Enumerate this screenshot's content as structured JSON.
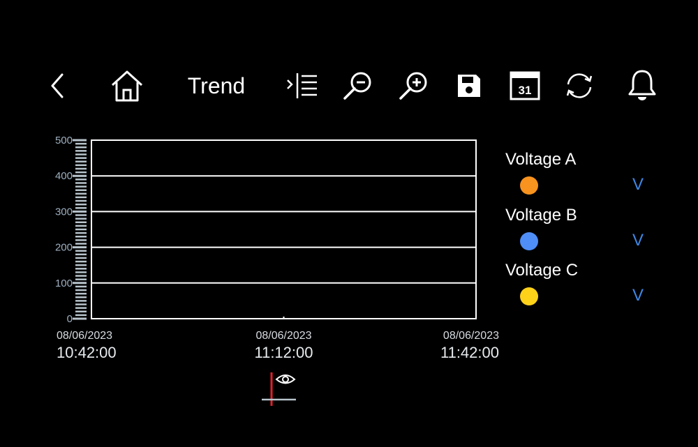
{
  "toolbar": {
    "title": "Trend",
    "buttons": [
      {
        "name": "back-button",
        "icon": "chevron-left-icon"
      },
      {
        "name": "home-button",
        "icon": "home-icon"
      },
      {
        "name": "legend-toggle-button",
        "icon": "list-expand-icon"
      },
      {
        "name": "zoom-out-button",
        "icon": "zoom-out-icon"
      },
      {
        "name": "zoom-in-button",
        "icon": "zoom-in-icon"
      },
      {
        "name": "save-button",
        "icon": "floppy-disk-icon"
      },
      {
        "name": "calendar-button",
        "icon": "calendar-icon",
        "calendar_day": "31"
      },
      {
        "name": "refresh-button",
        "icon": "refresh-icon"
      },
      {
        "name": "alarm-button",
        "icon": "bell-icon"
      }
    ]
  },
  "chart_data": {
    "type": "line",
    "y_ticks": [
      "500",
      "400",
      "300",
      "200",
      "100",
      "0"
    ],
    "ylim": [
      0,
      500
    ],
    "grid": true,
    "x_ticks": [
      {
        "date": "08/06/2023",
        "time": "10:42:00"
      },
      {
        "date": "08/06/2023",
        "time": "11:12:00"
      },
      {
        "date": "08/06/2023",
        "time": "11:42:00"
      }
    ],
    "series": [
      {
        "name": "Voltage A",
        "color": "#f7931e",
        "unit": "V",
        "values": []
      },
      {
        "name": "Voltage B",
        "color": "#4f8ef7",
        "unit": "V",
        "values": []
      },
      {
        "name": "Voltage C",
        "color": "#ffd21a",
        "unit": "V",
        "values": []
      }
    ]
  },
  "cursor_tool": {
    "icon": "eye-cursor-icon",
    "line_color": "#e0202a"
  }
}
